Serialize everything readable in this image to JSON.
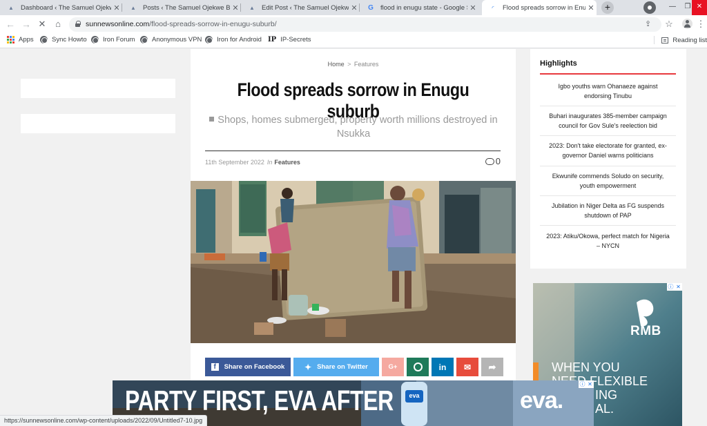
{
  "browser": {
    "tabs": [
      {
        "title": "Dashboard ‹ The Samuel Ojekwe Blog",
        "active": false
      },
      {
        "title": "Posts ‹ The Samuel Ojekwe Blog — W",
        "active": false
      },
      {
        "title": "Edit Post ‹ The Samuel Ojekwe Blog",
        "active": false
      },
      {
        "title": "flood in enugu state - Google Sear",
        "active": false
      },
      {
        "title": "Flood spreads sorrow in Enugu subu",
        "active": true
      }
    ],
    "new_tab_label": "+",
    "url_host": "sunnewsonline.com",
    "url_path": "/flood-spreads-sorrow-in-enugu-suburb/",
    "bookmarks": [
      {
        "label": "Apps",
        "icon": "apps-grid-icon"
      },
      {
        "label": "Sync Howto",
        "icon": "globe-icon"
      },
      {
        "label": "Iron Forum",
        "icon": "globe-icon"
      },
      {
        "label": "Anonymous VPN",
        "icon": "globe-icon"
      },
      {
        "label": "Iron for Android",
        "icon": "globe-icon"
      },
      {
        "label": "IP-Secrets",
        "icon": "ip-icon"
      }
    ],
    "reading_list_label": "Reading list",
    "status_url": "https://sunnewsonline.com/wp-content/uploads/2022/09/Untitled7-10.jpg"
  },
  "article": {
    "breadcrumb_home": "Home",
    "breadcrumb_sep": ">",
    "breadcrumb_current": "Features",
    "title": "Flood spreads sorrow in Enugu suburb",
    "subtitle": "Shops, homes submerged, property worth millions destroyed in Nsukka",
    "date": "11th September 2022",
    "in_label": "In",
    "category": "Features",
    "comment_count": "0"
  },
  "share": {
    "facebook": "Share on Facebook",
    "twitter": "Share on Twitter",
    "google_plus": "G+",
    "colors": {
      "facebook": "#3b5998",
      "twitter": "#55acee",
      "google_plus": "#f5a9a0",
      "whatsapp": "#1f7a5a",
      "linkedin": "#0077b5",
      "email": "#e74c3c",
      "more": "#b5b5b5"
    }
  },
  "highlights": {
    "title": "Highlights",
    "items": [
      "Igbo youths warn Ohanaeze against endorsing Tinubu",
      "Buhari inaugurates 385-member campaign council for Gov Sule's reelection bid",
      "2023: Don't take electorate for granted, ex-governor Daniel warns politicians",
      "Ekwunife commends Soludo on security, youth empowerment",
      "Jubilation in Niger Delta as FG suspends shutdown of PAP",
      "2023: Atiku/Okowa, perfect match for Nigeria – NYCN"
    ],
    "accent": "#e8383d"
  },
  "ads": {
    "rmb": {
      "brand": "RMB",
      "line1": "WHEN YOU",
      "line2": "NEED FLEXIBLE",
      "line3": "ING",
      "line4": "AL."
    },
    "eva": {
      "headline": "PARTY FIRST, EVA AFTER",
      "brand": "eva.",
      "bottle_label": "eva"
    }
  }
}
